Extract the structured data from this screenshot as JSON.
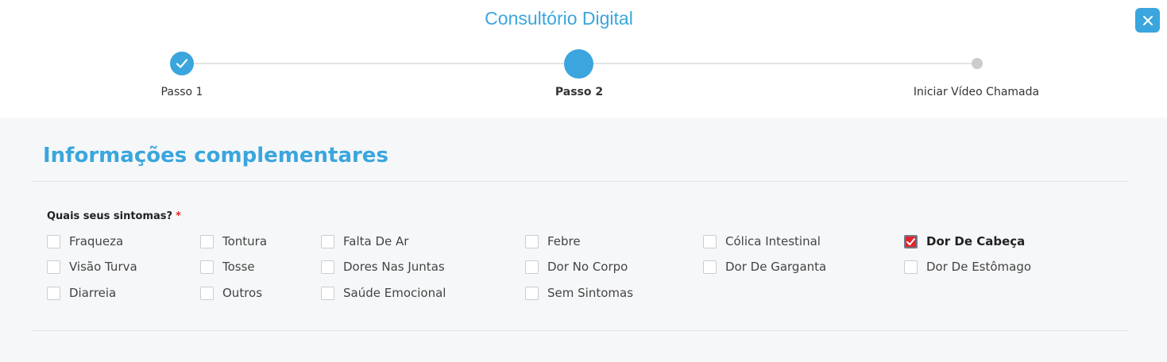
{
  "header": {
    "title": "Consultório Digital",
    "close_icon": "close-icon",
    "accent_color": "#3aa6dd"
  },
  "stepper": {
    "steps": [
      {
        "label": "Passo 1",
        "state": "completed",
        "icon": "check-icon"
      },
      {
        "label": "Passo 2",
        "state": "active"
      },
      {
        "label": "Iniciar Vídeo Chamada",
        "state": "pending"
      }
    ]
  },
  "form": {
    "section_title": "Informações complementares",
    "question": "Quais seus sintomas?",
    "required_mark": "*",
    "symptoms": [
      {
        "label": "Fraqueza",
        "checked": false
      },
      {
        "label": "Tontura",
        "checked": false
      },
      {
        "label": "Falta De Ar",
        "checked": false
      },
      {
        "label": "Febre",
        "checked": false
      },
      {
        "label": "Cólica Intestinal",
        "checked": false
      },
      {
        "label": "Dor De Cabeça",
        "checked": true
      },
      {
        "label": "Visão Turva",
        "checked": false
      },
      {
        "label": "Tosse",
        "checked": false
      },
      {
        "label": "Dores Nas Juntas",
        "checked": false
      },
      {
        "label": "Dor No Corpo",
        "checked": false
      },
      {
        "label": "Dor De Garganta",
        "checked": false
      },
      {
        "label": "Dor De Estômago",
        "checked": false
      },
      {
        "label": "Diarreia",
        "checked": false
      },
      {
        "label": "Outros",
        "checked": false
      },
      {
        "label": "Saúde Emocional",
        "checked": false
      },
      {
        "label": "Sem Sintomas",
        "checked": false
      }
    ]
  }
}
